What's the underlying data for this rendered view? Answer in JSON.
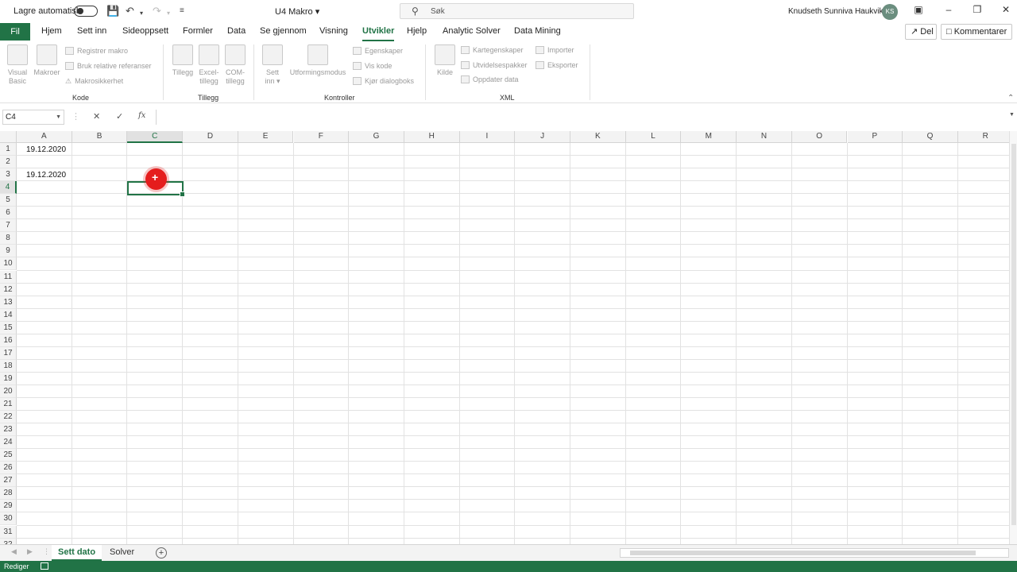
{
  "titlebar": {
    "autosave_label": "Lagre automatisk",
    "doc_title": "U4 Makro",
    "search_placeholder": "Søk",
    "user_name": "Knudseth Sunniva Haukvik",
    "user_initials": "KS"
  },
  "tabs": {
    "fil": "Fil",
    "items": [
      "Hjem",
      "Sett inn",
      "Sideoppsett",
      "Formler",
      "Data",
      "Se gjennom",
      "Visning",
      "Utvikler",
      "Hjelp",
      "Analytic Solver",
      "Data Mining"
    ],
    "active": "Utvikler",
    "share_label": "Del",
    "comments_label": "Kommentarer"
  },
  "ribbon": {
    "kode": {
      "group_label": "Kode",
      "visual_basic": "Visual Basic",
      "makroer": "Makroer",
      "registrer_makro": "Registrer makro",
      "relative_ref": "Bruk relative referanser",
      "makrosikkerhet": "Makrosikkerhet"
    },
    "tillegg": {
      "group_label": "Tillegg",
      "tillegg": "Tillegg",
      "excel_tillegg_1": "Excel-",
      "excel_tillegg_2": "tillegg",
      "com_tillegg_1": "COM-",
      "com_tillegg_2": "tillegg"
    },
    "kontroller": {
      "group_label": "Kontroller",
      "sett_inn": "Sett inn",
      "utformingsmodus": "Utformingsmodus",
      "egenskaper": "Egenskaper",
      "vis_kode": "Vis kode",
      "kjor_dialogboks": "Kjør dialogboks"
    },
    "xml": {
      "group_label": "XML",
      "kilde": "Kilde",
      "kartegenskaper": "Kartegenskaper",
      "utvidelsespakker": "Utvidelsespakker",
      "oppdater_data": "Oppdater data",
      "importer": "Importer",
      "eksporter": "Eksporter"
    }
  },
  "formula_bar": {
    "name_box": "C4",
    "formula": ""
  },
  "grid": {
    "columns": [
      "A",
      "B",
      "C",
      "D",
      "E",
      "F",
      "G",
      "H",
      "I",
      "J",
      "K",
      "L",
      "M",
      "N",
      "O",
      "P",
      "Q",
      "R"
    ],
    "selected_column": "C",
    "selected_row": 4,
    "cells": {
      "A1": "19.12.2020",
      "A3": "19.12.2020"
    }
  },
  "sheets": {
    "tabs": [
      "Sett dato",
      "Solver"
    ],
    "active": "Sett dato"
  },
  "status": {
    "mode": "Rediger"
  },
  "colors": {
    "accent": "#217346"
  }
}
